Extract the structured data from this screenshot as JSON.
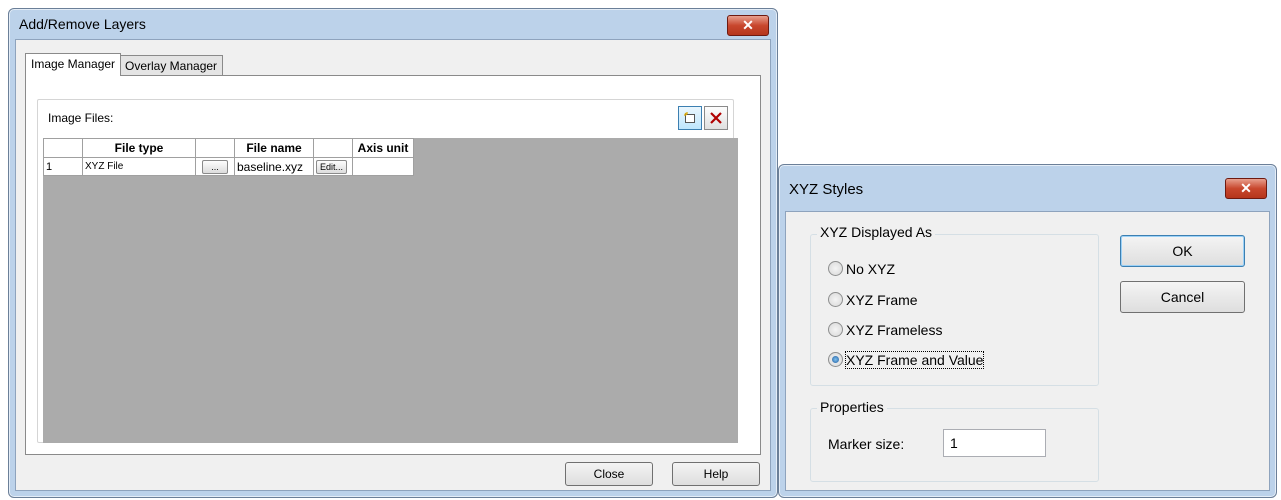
{
  "layers_dialog": {
    "title": "Add/Remove Layers",
    "close_glyph": "✕",
    "tabs": [
      {
        "label": "Image Manager",
        "active": true
      },
      {
        "label": "Overlay Manager",
        "active": false
      }
    ],
    "group_label": "Image Files:",
    "new_icon": "new-file-icon",
    "delete_icon": "delete-x-icon",
    "grid": {
      "headers": [
        "",
        "File type",
        "",
        "File name",
        "",
        "Axis unit"
      ],
      "rows": [
        {
          "index": "1",
          "file_type": "XYZ File",
          "browse": "...",
          "file_name": "baseline.xyz",
          "edit": "Edit...",
          "axis_unit": ""
        }
      ]
    },
    "buttons": {
      "close": "Close",
      "help": "Help"
    }
  },
  "xyz_dialog": {
    "title": "XYZ Styles",
    "close_glyph": "✕",
    "displayed_as": {
      "title": "XYZ Displayed As",
      "options": [
        {
          "label": "No XYZ",
          "checked": false
        },
        {
          "label": "XYZ Frame",
          "checked": false
        },
        {
          "label": "XYZ Frameless",
          "checked": false
        },
        {
          "label": "XYZ Frame and Value",
          "checked": true
        }
      ]
    },
    "properties": {
      "title": "Properties",
      "marker_label": "Marker size:",
      "marker_value": "1"
    },
    "buttons": {
      "ok": "OK",
      "cancel": "Cancel"
    }
  },
  "colors": {
    "frame": "#bcd2ea",
    "client": "#f0f0f0",
    "close_red": "#c8472d",
    "grid_empty": "#ababab"
  }
}
